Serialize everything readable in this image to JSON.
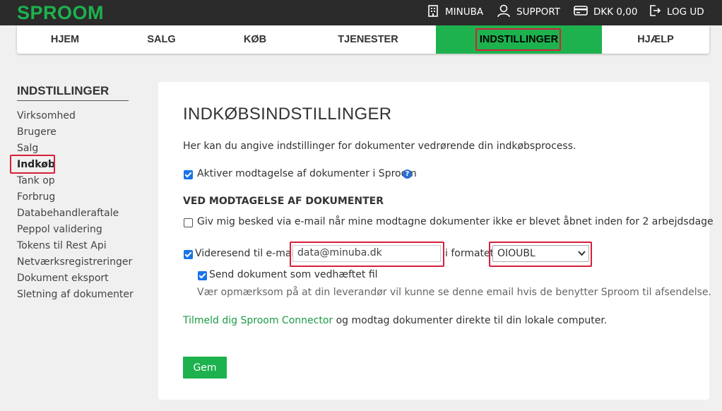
{
  "brand": {
    "logo_text": "SPROOM",
    "accent": "#1db24e",
    "highlight": "#d6203a"
  },
  "topbar": {
    "items": [
      {
        "label": "MINUBA",
        "icon": "building-icon"
      },
      {
        "label": "SUPPORT",
        "icon": "user-icon"
      },
      {
        "label": "DKK 0,00",
        "icon": "credit-card-icon"
      },
      {
        "label": "LOG UD",
        "icon": "logout-icon"
      }
    ]
  },
  "nav": {
    "tabs": [
      {
        "label": "HJEM"
      },
      {
        "label": "SALG"
      },
      {
        "label": "KØB"
      },
      {
        "label": "TJENESTER"
      },
      {
        "label": "INDSTILLINGER",
        "active": true
      },
      {
        "label": "HJÆLP"
      }
    ]
  },
  "sidebar": {
    "title": "INDSTILLINGER",
    "items": [
      {
        "label": "Virksomhed"
      },
      {
        "label": "Brugere"
      },
      {
        "label": "Salg"
      },
      {
        "label": "Indkøb",
        "active": true
      },
      {
        "label": "Tank op"
      },
      {
        "label": "Forbrug"
      },
      {
        "label": "Databehandleraftale"
      },
      {
        "label": "Peppol validering"
      },
      {
        "label": "Tokens til Rest Api"
      },
      {
        "label": "Netværksregistreringer"
      },
      {
        "label": "Dokument eksport"
      },
      {
        "label": "Sletning af dokumenter"
      }
    ]
  },
  "main": {
    "title": "INDKØBSINDSTILLINGER",
    "intro": "Her kan du angive indstillinger for dokumenter vedrørende din indkøbsprocess.",
    "activate": {
      "label": "Aktiver modtagelse af dokumenter i Sproom",
      "checked": true
    },
    "section_heading": "VED MODTAGELSE AF DOKUMENTER",
    "notify": {
      "label": "Giv mig besked via e-mail når mine modtagne dokumenter ikke er blevet åbnet inden for 2 arbejdsdage",
      "checked": false
    },
    "forward": {
      "label": "Videresend til e-mail",
      "checked": true,
      "email_value": "data@minuba.dk",
      "format_label": "i formatet",
      "format_value": "OIOUBL"
    },
    "attach": {
      "label": "Send dokument som vedhæftet fil",
      "checked": true
    },
    "attach_note": "Vær opmærksom på at din leverandør vil kunne se denne email hvis de benytter Sproom til afsendelse.",
    "connector_link": "Tilmeld dig Sproom Connector",
    "connector_rest": "og modtag dokumenter direkte til din lokale computer.",
    "save_label": "Gem"
  }
}
